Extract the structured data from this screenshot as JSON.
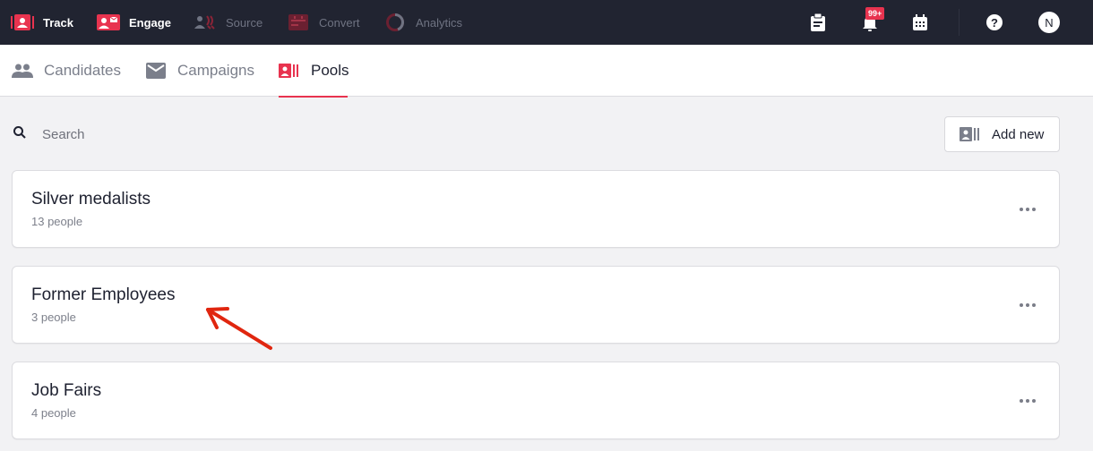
{
  "topnav": {
    "items": [
      {
        "label": "Track",
        "icon": "track-icon",
        "state": "active"
      },
      {
        "label": "Engage",
        "icon": "engage-icon",
        "state": "active"
      },
      {
        "label": "Source",
        "icon": "source-icon",
        "state": "dim"
      },
      {
        "label": "Convert",
        "icon": "convert-icon",
        "state": "dim"
      },
      {
        "label": "Analytics",
        "icon": "analytics-icon",
        "state": "dim"
      }
    ],
    "right": {
      "clipboard_icon": "clipboard-icon",
      "notifications_icon": "bell-icon",
      "notifications_badge": "99+",
      "calendar_icon": "calendar-icon",
      "help_icon": "help-icon",
      "avatar_initial": "N"
    }
  },
  "tabs": [
    {
      "label": "Candidates",
      "icon": "people-icon",
      "active": false
    },
    {
      "label": "Campaigns",
      "icon": "mail-icon",
      "active": false
    },
    {
      "label": "Pools",
      "icon": "pool-icon",
      "active": true
    }
  ],
  "search": {
    "placeholder": "Search",
    "value": ""
  },
  "add_new": {
    "label": "Add new",
    "icon": "pool-icon"
  },
  "pools": [
    {
      "name": "Silver medalists",
      "count": "13 people"
    },
    {
      "name": "Former Employees",
      "count": "3 people"
    },
    {
      "name": "Job Fairs",
      "count": "4 people"
    }
  ],
  "colors": {
    "accent": "#e8334f",
    "topbar_bg": "#212431",
    "page_bg": "#f2f2f4",
    "annotation": "#e0260f"
  }
}
